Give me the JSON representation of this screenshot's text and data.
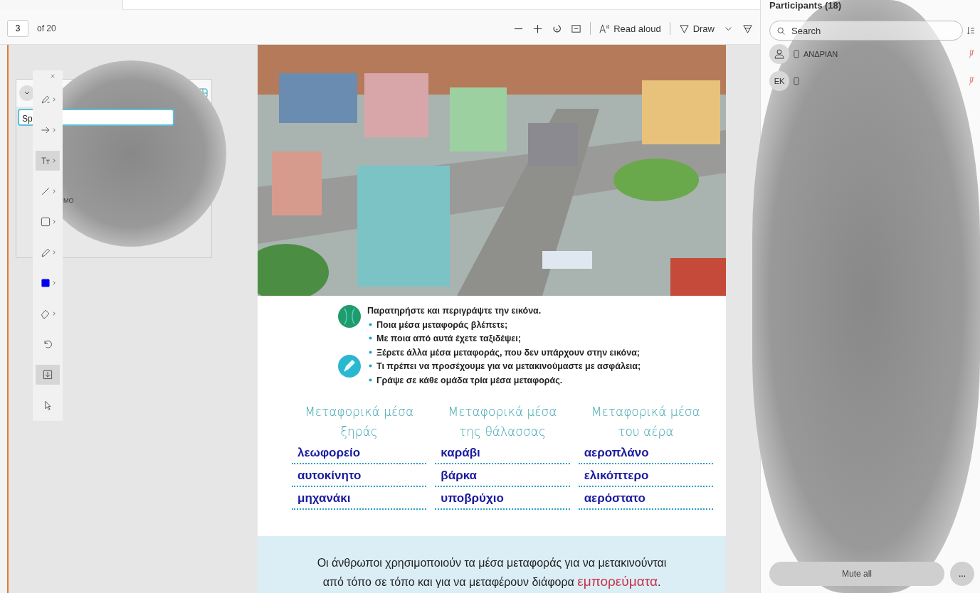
{
  "toolbar": {
    "page": "3",
    "page_count": "of 20",
    "read_aloud": "Read aloud",
    "draw": "Draw"
  },
  "video_panel": {
    "speaker": "Sp",
    "name": "ΜΟ"
  },
  "draw_tools": [
    {
      "kind": "pen",
      "selected": false
    },
    {
      "kind": "arrow",
      "selected": false
    },
    {
      "kind": "text",
      "selected": true
    },
    {
      "kind": "line",
      "selected": false
    },
    {
      "kind": "rectangle",
      "selected": false
    },
    {
      "kind": "pencil",
      "selected": false
    },
    {
      "kind": "color",
      "selected": false
    },
    {
      "kind": "eraser",
      "selected": false
    },
    {
      "kind": "undo",
      "selected": false
    },
    {
      "kind": "save",
      "selected": true
    },
    {
      "kind": "pointer",
      "selected": false
    }
  ],
  "document": {
    "prompt": "Παρατηρήστε και περιγράψτε την εικόνα.",
    "bullets": [
      "Ποια μέσα μεταφοράς βλέπετε;",
      "Με ποια από αυτά έχετε ταξιδέψει;",
      "Ξέρετε άλλα μέσα μεταφοράς, που δεν υπάρχουν στην εικόνα;",
      "Τι πρέπει να προσέχουμε για να μετακινούμαστε με ασφάλεια;",
      "Γράψε σε κάθε ομάδα τρία μέσα μεταφοράς."
    ],
    "columns": [
      {
        "heading": [
          "Μεταφορικά μέσα",
          "ξηράς"
        ],
        "answers": [
          "λεωφορείο",
          "αυτοκίνητο",
          "μηχανάκι"
        ]
      },
      {
        "heading": [
          "Μεταφορικά μέσα",
          "της θάλασσας"
        ],
        "answers": [
          "καράβι",
          "βάρκα",
          "υποβρύχιο"
        ]
      },
      {
        "heading": [
          "Μεταφορικά μέσα",
          "του αέρα"
        ],
        "answers": [
          "αεροπλάνο",
          "ελικόπτερο",
          "αερόστατο"
        ]
      }
    ],
    "summary": [
      "Οι άνθρωποι χρησιμοποιούν τα μέσα μεταφοράς για να μετακινούνται",
      "από τόπο σε τόπο και για να μεταφέρουν διάφορα"
    ],
    "summary_highlight": "εμπορεύματα",
    "summary_end": "."
  },
  "participants": {
    "title": "Participants (18)",
    "search_placeholder": "Search",
    "rows": [
      {
        "initials": "",
        "name": "ΑΝΔΡΙΑΝ",
        "muted": true
      },
      {
        "initials": "EK",
        "name": "",
        "muted": true
      }
    ],
    "mute_all": "Mute all",
    "more": "..."
  }
}
